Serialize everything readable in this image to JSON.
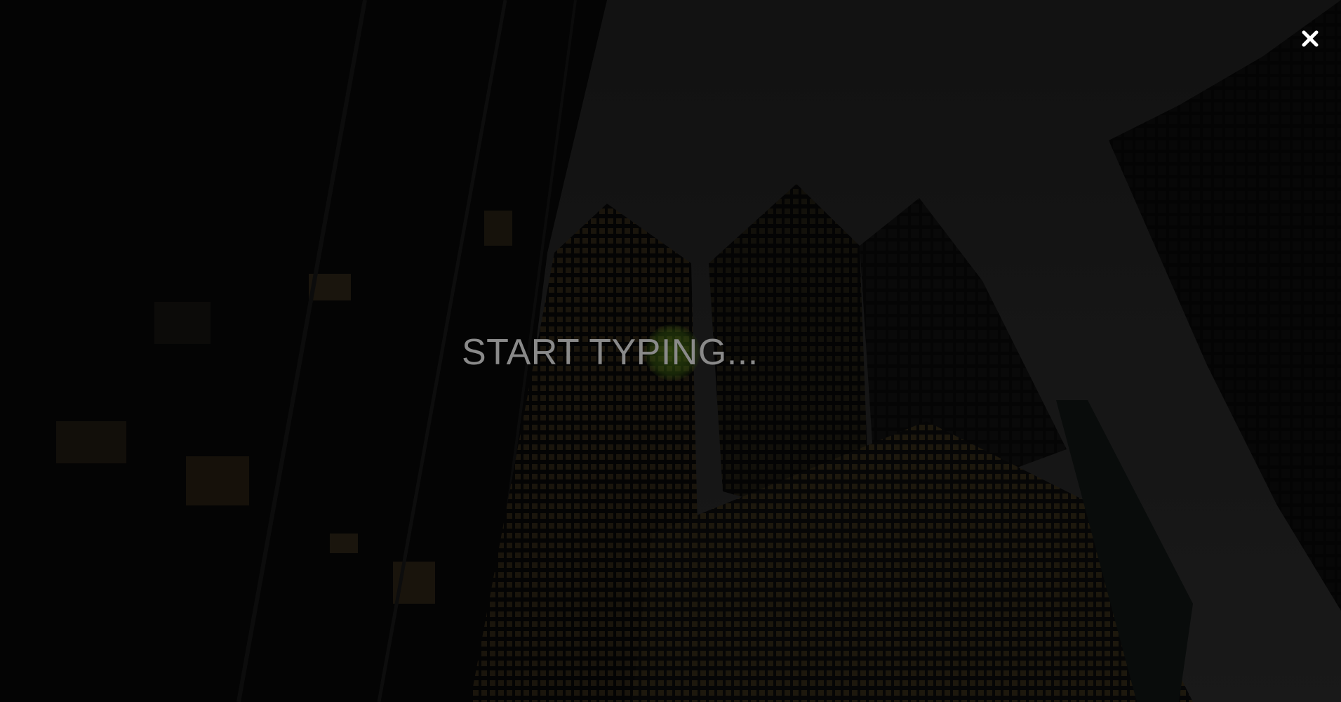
{
  "overlay": {
    "search": {
      "placeholder": "START TYPING...",
      "value": ""
    },
    "close_icon": "close-icon",
    "accent_color": "#5a8a1a"
  }
}
